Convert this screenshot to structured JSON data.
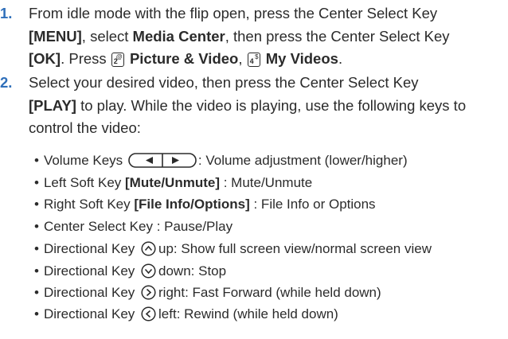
{
  "steps": [
    {
      "number": "1.",
      "parts": {
        "a": "From idle mode with the flip open, press the Center Select Key",
        "menu": "[MENU]",
        "b": ", select ",
        "media": "Media Center",
        "c": ", then press the Center Select Key",
        "ok": "[OK]",
        "d": ". Press ",
        "key1_digit": "2",
        "key1_symbol": "@",
        "pv": "Picture & Video",
        "e": ", ",
        "key2_digit": "4",
        "key2_symbol": "$",
        "myv": "My Videos",
        "f": "."
      }
    },
    {
      "number": "2.",
      "parts": {
        "a": "Select your desired video, then press the Center Select Key",
        "play": "[PLAY]",
        "b": " to play. While the video is playing, use the following keys to control the video:"
      }
    }
  ],
  "bullets": {
    "volume": {
      "prefix": "Volume Keys",
      "suffix": ": Volume adjustment (lower/higher)"
    },
    "left_soft": {
      "prefix": "Left Soft Key ",
      "key": "[Mute/Unmute]",
      "suffix": " : Mute/Unmute"
    },
    "right_soft": {
      "prefix": "Right Soft Key ",
      "key": "[File Info/Options]",
      "suffix": " : File Info or Options"
    },
    "center": {
      "text": "Center Select Key : Pause/Play"
    },
    "dir_up": {
      "prefix": "Directional Key",
      "suffix": "up: Show full screen view/normal screen view",
      "icon": "dpad-up-icon"
    },
    "dir_down": {
      "prefix": "Directional Key",
      "suffix": "down: Stop",
      "icon": "dpad-down-icon"
    },
    "dir_right": {
      "prefix": "Directional Key",
      "suffix": "right: Fast Forward (while held down)",
      "icon": "dpad-right-icon"
    },
    "dir_left": {
      "prefix": "Directional Key",
      "suffix": "left: Rewind (while held down)",
      "icon": "dpad-left-icon"
    }
  },
  "colors": {
    "step_number": "#2f6fba",
    "text": "#2b2b2b"
  }
}
